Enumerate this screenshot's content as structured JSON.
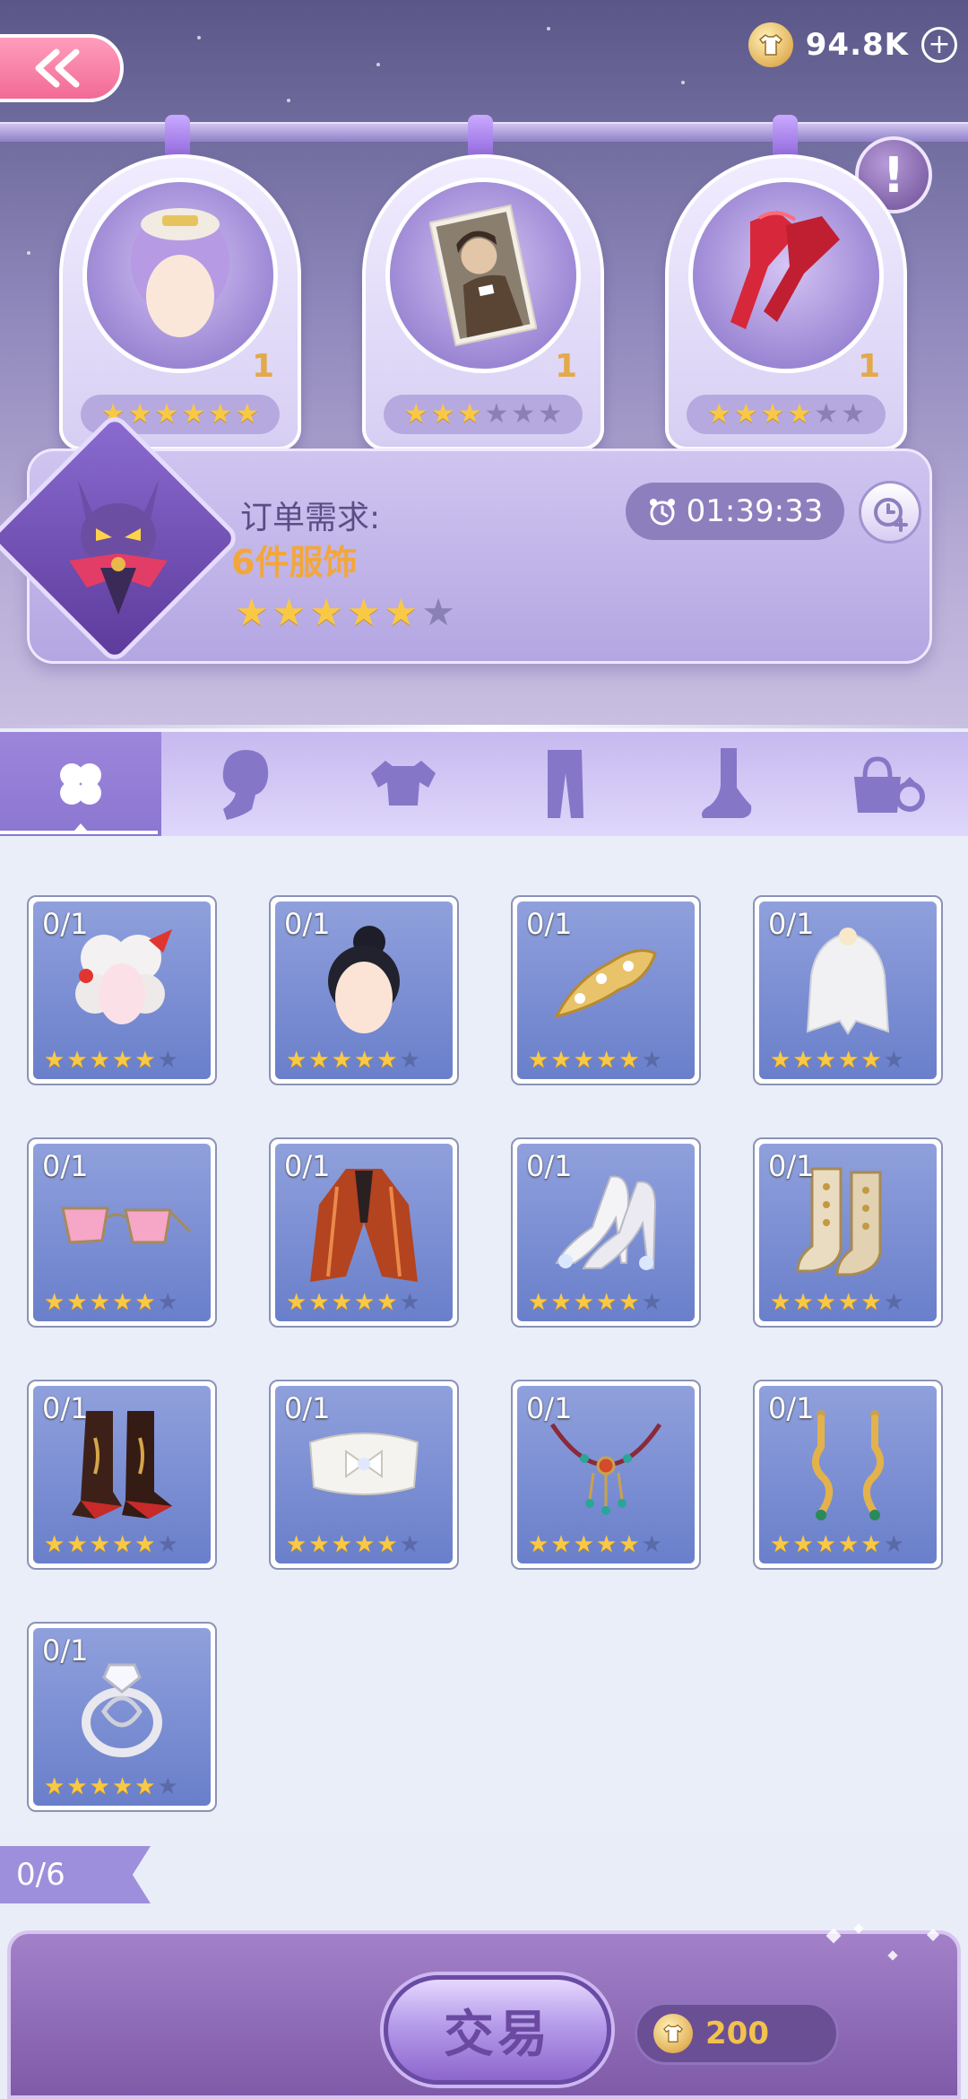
{
  "header": {
    "back_icon": "double-chevron-left-icon",
    "coins": "94.8K",
    "coin_icon": "shirt-coin-icon",
    "add_icon": "plus-circle-icon"
  },
  "info_button": "!",
  "featured": [
    {
      "name": "purple-wig-item",
      "count": "1",
      "rating": 6,
      "max": 6
    },
    {
      "name": "portrait-card-item",
      "count": "1",
      "rating": 3,
      "max": 6
    },
    {
      "name": "red-gloves-item",
      "count": "1",
      "rating": 4,
      "max": 6
    }
  ],
  "order": {
    "label": "订单需求:",
    "quantity": "6件服饰",
    "rating": 5,
    "max": 6,
    "timer": "01:39:33",
    "timer_icon": "clock-icon",
    "add_time_icon": "clock-plus-icon"
  },
  "tabs": [
    {
      "name": "tab-all",
      "icon": "clover-icon",
      "active": true
    },
    {
      "name": "tab-hair",
      "icon": "head-silhouette-icon",
      "active": false
    },
    {
      "name": "tab-tops",
      "icon": "top-silhouette-icon",
      "active": false
    },
    {
      "name": "tab-bottoms",
      "icon": "pants-silhouette-icon",
      "active": false
    },
    {
      "name": "tab-shoes",
      "icon": "foot-silhouette-icon",
      "active": false
    },
    {
      "name": "tab-accessories",
      "icon": "bag-ring-icon",
      "active": false
    }
  ],
  "items": [
    {
      "count": "0/1",
      "art": "white-wig-icon",
      "rating": 5
    },
    {
      "count": "0/1",
      "art": "black-bun-hair-icon",
      "rating": 5
    },
    {
      "count": "0/1",
      "art": "gold-hairpin-icon",
      "rating": 5
    },
    {
      "count": "0/1",
      "art": "bridal-veil-icon",
      "rating": 5
    },
    {
      "count": "0/1",
      "art": "pink-glasses-icon",
      "rating": 5
    },
    {
      "count": "0/1",
      "art": "red-robe-icon",
      "rating": 5
    },
    {
      "count": "0/1",
      "art": "crystal-heels-icon",
      "rating": 5
    },
    {
      "count": "0/1",
      "art": "lace-boots-icon",
      "rating": 5
    },
    {
      "count": "0/1",
      "art": "red-boots-icon",
      "rating": 5
    },
    {
      "count": "0/1",
      "art": "white-bow-belt-icon",
      "rating": 5
    },
    {
      "count": "0/1",
      "art": "jeweled-necklace-icon",
      "rating": 5
    },
    {
      "count": "0/1",
      "art": "gold-earrings-icon",
      "rating": 5
    },
    {
      "count": "0/1",
      "art": "silver-ring-icon",
      "rating": 5
    }
  ],
  "progress": "0/6",
  "footer": {
    "trade_label": "交易",
    "cost": "200",
    "cost_icon": "shirt-coin-icon"
  }
}
